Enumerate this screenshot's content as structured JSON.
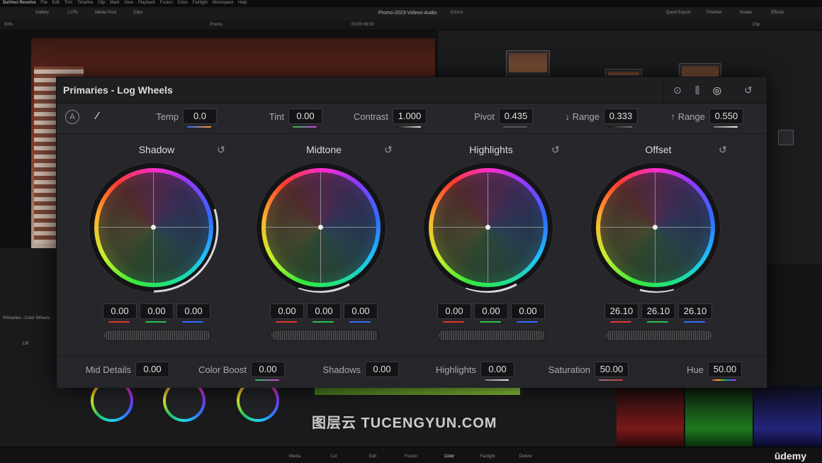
{
  "menubar": {
    "app": "DaVinci Resolve",
    "items": [
      "File",
      "Edit",
      "Trim",
      "Timeline",
      "Clip",
      "Mark",
      "View",
      "Playback",
      "Fusion",
      "Color",
      "Fairlight",
      "Workspace",
      "Help"
    ]
  },
  "toolbar": {
    "project_title": "Promo-2023-Videos-Audio",
    "project_status": "Edited",
    "left_tools": [
      "Gallery",
      "LUTs",
      "Media Pool",
      "Clips"
    ],
    "right_tools": [
      "Quick Export",
      "Timeline",
      "Nodes",
      "Effects"
    ]
  },
  "subbar": {
    "zoom": "50%",
    "timeline_name": "Promo",
    "timecode": "00:00:06:03",
    "node_mode": "Clip"
  },
  "panel": {
    "title": "Primaries - Log Wheels",
    "adjust": [
      {
        "label": "Temp",
        "value": "0.0"
      },
      {
        "label": "Tint",
        "value": "0.00"
      },
      {
        "label": "Contrast",
        "value": "1.000"
      },
      {
        "label": "Pivot",
        "value": "0.435"
      },
      {
        "label": "↓ Range",
        "value": "0.333"
      },
      {
        "label": "↑ Range",
        "value": "0.550"
      }
    ],
    "wheels": [
      {
        "name": "Shadow",
        "values": [
          "0.00",
          "0.00",
          "0.00"
        ]
      },
      {
        "name": "Midtone",
        "values": [
          "0.00",
          "0.00",
          "0.00"
        ]
      },
      {
        "name": "Highlights",
        "values": [
          "0.00",
          "0.00",
          "0.00"
        ]
      },
      {
        "name": "Offset",
        "values": [
          "26.10",
          "26.10",
          "26.10"
        ]
      }
    ],
    "bottom": [
      {
        "label": "Mid Details",
        "value": "0.00"
      },
      {
        "label": "Color Boost",
        "value": "0.00"
      },
      {
        "label": "Shadows",
        "value": "0.00"
      },
      {
        "label": "Highlights",
        "value": "0.00"
      },
      {
        "label": "Saturation",
        "value": "50.00"
      },
      {
        "label": "Hue",
        "value": "50.00"
      }
    ],
    "icons": {
      "auto": "A",
      "picker": "⁄",
      "reset": "↺"
    }
  },
  "left_panel": {
    "title": "Primaries - Color Wheels",
    "lift": "Lift"
  },
  "pages": [
    "Media",
    "Cut",
    "Edit",
    "Fusion",
    "Color",
    "Fairlight",
    "Deliver"
  ],
  "active_page": "Color",
  "watermark": "图层云 TUCENGYUN.COM",
  "brand": "ūdemy",
  "colors": {
    "panel_bg": "#27272b",
    "red": "#e0362f",
    "green": "#27c24a",
    "blue": "#2d6bff"
  }
}
